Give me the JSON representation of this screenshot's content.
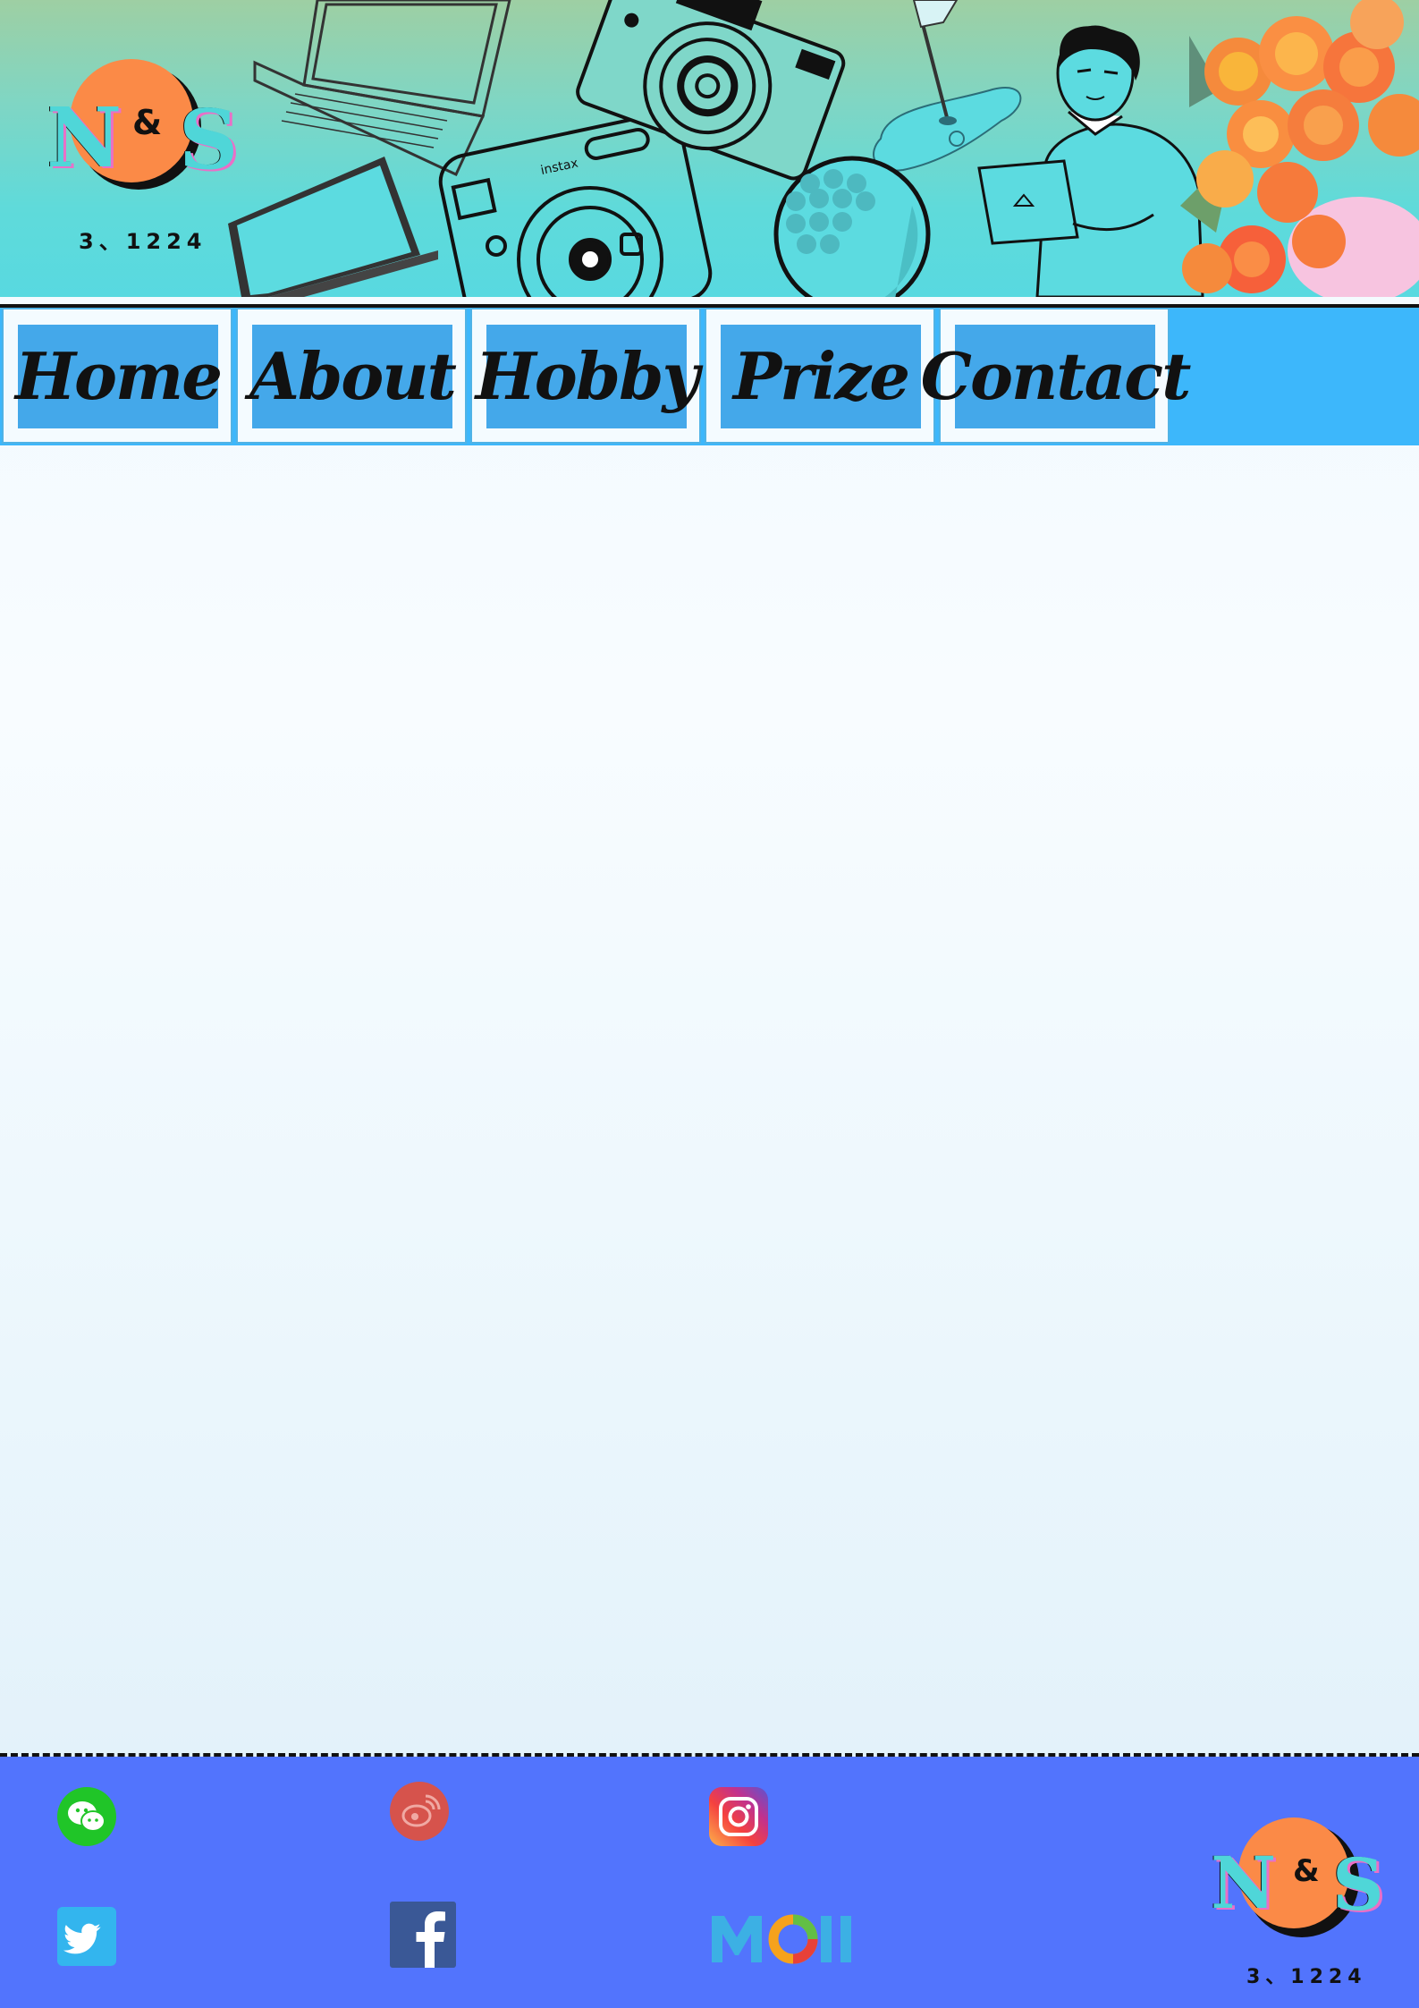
{
  "banner": {
    "logo": {
      "left_letter": "N",
      "amp": "&",
      "right_letter": "S",
      "date": "3、1224"
    }
  },
  "nav": {
    "items": [
      {
        "label": "Home"
      },
      {
        "label": "About"
      },
      {
        "label": "Hobby"
      },
      {
        "label": "Prize"
      },
      {
        "label": "Contact"
      }
    ]
  },
  "footer": {
    "social": [
      "wechat-icon",
      "weibo-icon",
      "instagram-icon",
      "twitter-icon",
      "facebook-icon",
      "moji-logo"
    ],
    "logo": {
      "left_letter": "N",
      "amp": "&",
      "right_letter": "S",
      "date": "3、1224"
    }
  },
  "colors": {
    "nav_bar": "#3db7fb",
    "nav_button": "#44a8ea",
    "footer": "#5274fd",
    "logo_circle": "#fb8a47",
    "logo_letters": "#4fd6d8"
  }
}
